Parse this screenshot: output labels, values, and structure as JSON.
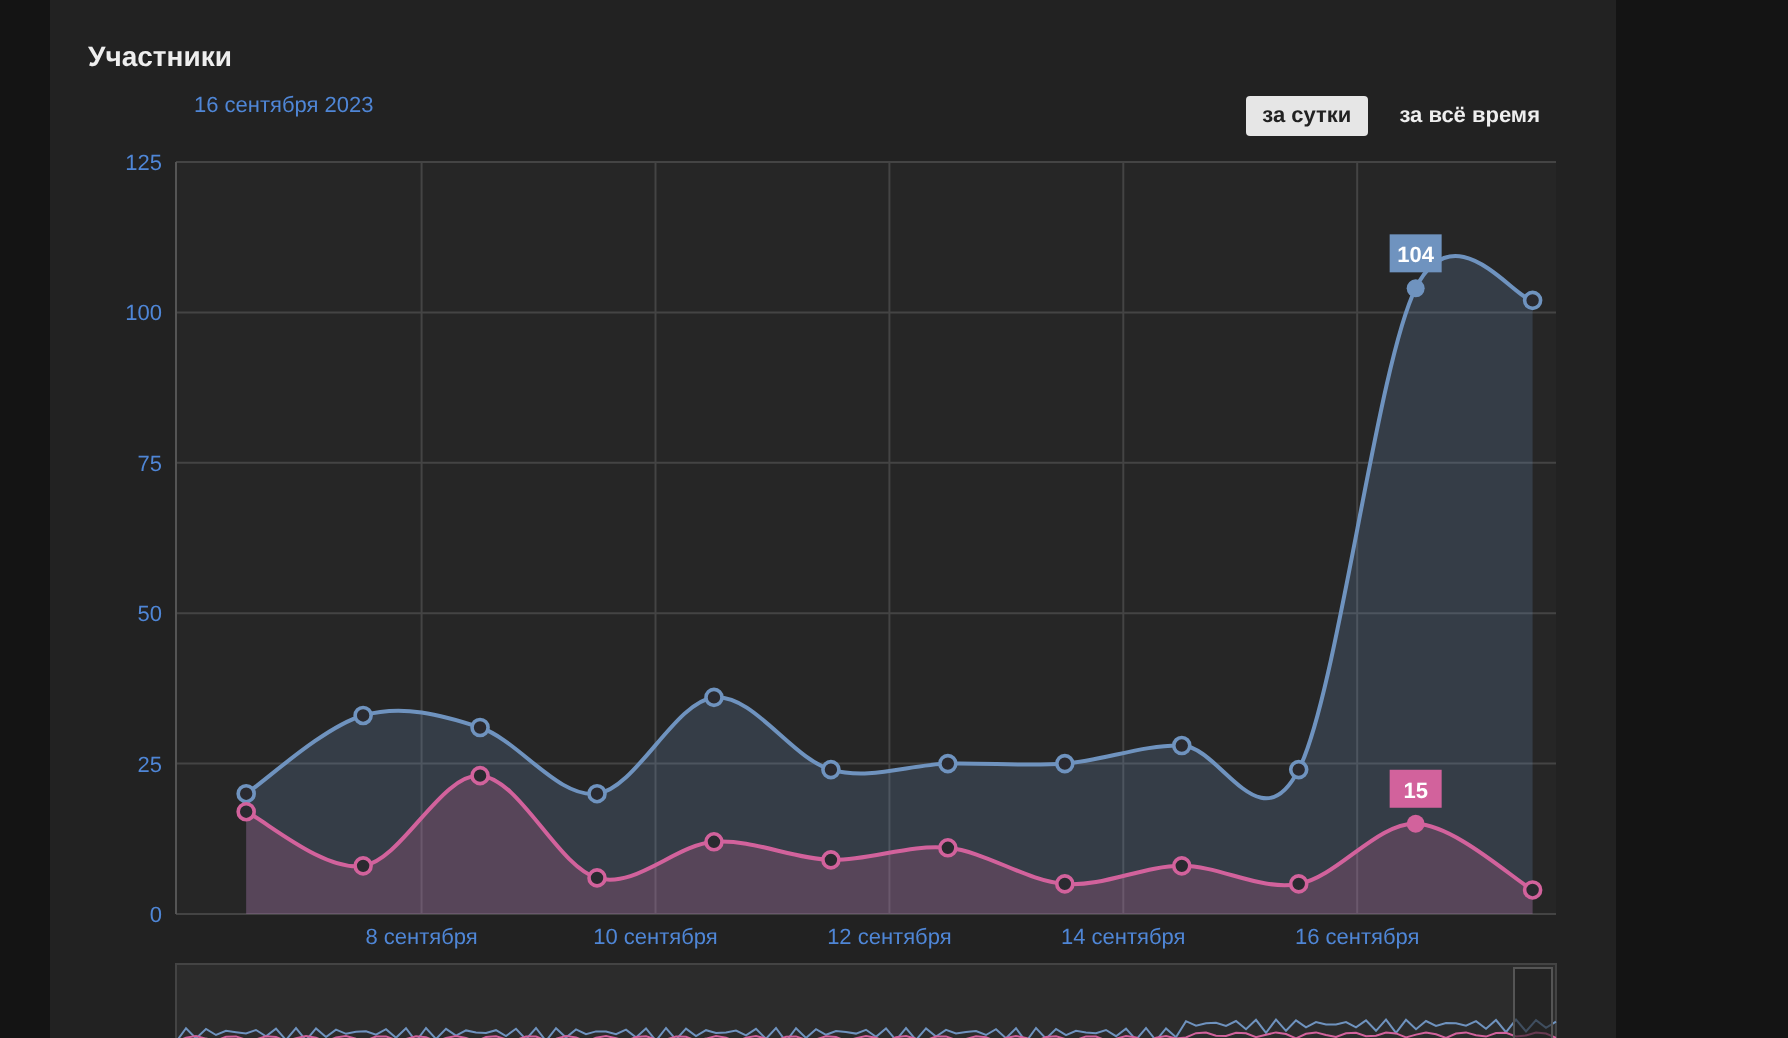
{
  "panel": {
    "title": "Участники",
    "date": "16 сентября 2023",
    "tabs": [
      {
        "label": "за сутки",
        "selected": true
      },
      {
        "label": "за всё время",
        "selected": false
      }
    ],
    "chart_data": {
      "type": "area",
      "x": [
        6.5,
        7.5,
        8.5,
        9.5,
        10.5,
        11.5,
        12.5,
        13.5,
        14.5,
        15.5,
        16.5,
        17.5
      ],
      "series": [
        {
          "color": "#6f93bf",
          "values": [
            20,
            33,
            31,
            20,
            36,
            24,
            25,
            25,
            28,
            24,
            104,
            102
          ]
        },
        {
          "color": "#d2629c",
          "values": [
            17,
            8,
            23,
            6,
            12,
            9,
            11,
            5,
            8,
            5,
            15,
            4
          ]
        }
      ],
      "grid": true,
      "xlim": [
        5.9,
        17.7
      ],
      "ylim": [
        0,
        125
      ],
      "yticks": [
        0,
        25,
        50,
        75,
        100,
        125
      ],
      "xticks": [
        {
          "value": 8,
          "label": "8 сентября"
        },
        {
          "value": 10,
          "label": "10 сентября"
        },
        {
          "value": 12,
          "label": "12 сентября"
        },
        {
          "value": 14,
          "label": "14 сентября"
        },
        {
          "value": 16,
          "label": "16 сентября"
        }
      ],
      "annotations": [
        {
          "x": 16.5,
          "y": 104,
          "text": "104"
        },
        {
          "x": 16.5,
          "y": 15,
          "text": "15"
        }
      ]
    }
  }
}
